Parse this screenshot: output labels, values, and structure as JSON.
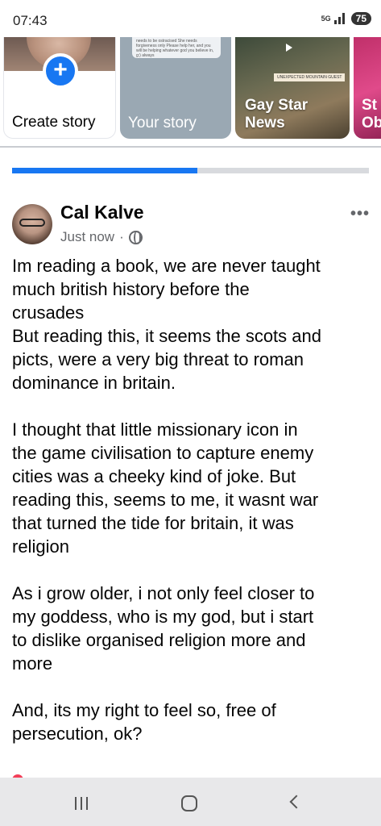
{
  "status_bar": {
    "time": "07:43",
    "network": "5G",
    "battery": "75",
    "signal_bars": 3
  },
  "stories": {
    "create_label": "Create story",
    "your_story_label": "Your story",
    "your_story_preview": "needs to be ostracised She needs forgiveness only Please help her, and you will be helping whatever god you believe in, g:) always",
    "news_label_line1": "Gay Star",
    "news_label_line2": "News",
    "news_badge": "UNEXPECTED MOUNTAIN GUEST",
    "next_label_line1": "St",
    "next_label_line2": "Ob"
  },
  "upload": {
    "progress_percent": 52
  },
  "post": {
    "author": "Cal Kalve",
    "timestamp": "Just now",
    "separator": "·",
    "paragraphs": [
      [
        "Im reading a book, we are never taught",
        "much british history before the",
        "crusades",
        "But reading this, it seems the scots and",
        "picts, were a very big threat to roman",
        "dominance in britain."
      ],
      [
        "I thought that little missionary icon in",
        "the game civilisation to capture enemy",
        "cities was a cheeky kind of joke. But",
        "reading this, seems to me, it wasnt war",
        "that turned the tide for britain, it was",
        "religion"
      ],
      [
        "As i grow older, i not only feel closer to",
        "my goddess, who is my god, but i start",
        "to dislike organised religion more and",
        "more"
      ],
      [
        "And, its my right to feel so, free of",
        "persecution, ok?"
      ]
    ]
  },
  "colors": {
    "accent": "#1877f2",
    "secondary_text": "#65676b"
  }
}
